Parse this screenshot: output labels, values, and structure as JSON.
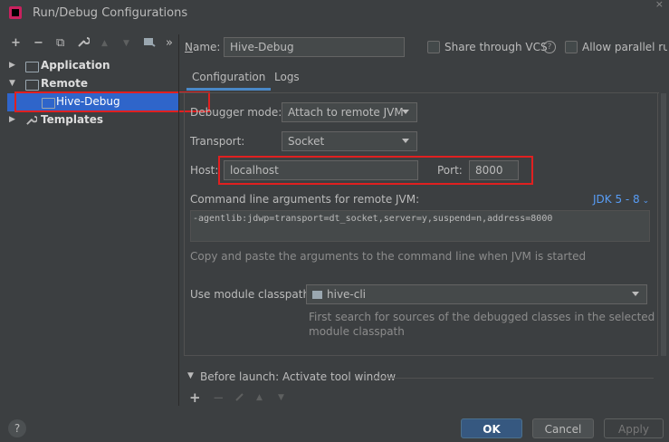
{
  "window": {
    "title": "Run/Debug Configurations"
  },
  "toolbar": {
    "add": "+",
    "remove": "−",
    "copy": "⧉",
    "wrench": "🔧",
    "up": "▲",
    "down": "▼",
    "more": "»"
  },
  "tree": {
    "application": "Application",
    "remote": "Remote",
    "hive_debug": "Hive-Debug",
    "templates": "Templates"
  },
  "header": {
    "name_label": "Name:",
    "name_value": "Hive-Debug",
    "share_label": "Share through VCS",
    "parallel_label": "Allow parallel run"
  },
  "tabs": [
    "Configuration",
    "Logs"
  ],
  "config": {
    "debugger_mode_label": "Debugger mode:",
    "debugger_mode_value": "Attach to remote JVM",
    "transport_label": "Transport:",
    "transport_value": "Socket",
    "host_label": "Host:",
    "host_value": "localhost",
    "port_label": "Port:",
    "port_value": "8000",
    "cmd_label": "Command line arguments for remote JVM:",
    "jdk_label": "JDK 5 - 8",
    "cmd_value": "-agentlib:jdwp=transport=dt_socket,server=y,suspend=n,address=8000",
    "cmd_hint": "Copy and paste the arguments to the command line when JVM is started",
    "module_label": "Use module classpath:",
    "module_value": "hive-cli",
    "module_hint_1": "First search for sources of the debugged classes in the selected",
    "module_hint_2": "module classpath"
  },
  "before_launch": {
    "label": "Before launch: Activate tool window"
  },
  "buttons": {
    "help": "?",
    "ok": "OK",
    "cancel": "Cancel",
    "apply": "Apply"
  },
  "colors": {
    "accent": "#4a88c7",
    "selection": "#2f65ca",
    "highlight": "#e02020"
  }
}
